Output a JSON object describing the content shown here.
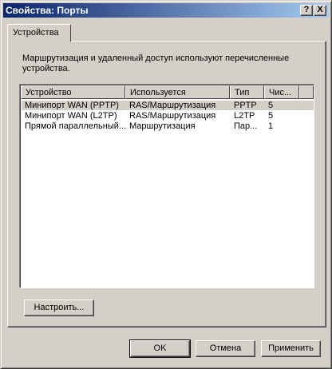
{
  "window": {
    "title": "Свойства: Порты"
  },
  "titlebar_buttons": {
    "help": "?",
    "close": "X"
  },
  "tabs": [
    {
      "label": "Устройства"
    }
  ],
  "description": "Маршрутизация и удаленный доступ используют перечисленные устройства.",
  "table": {
    "columns": [
      "Устройство",
      "Используется",
      "Тип",
      "Чис..."
    ],
    "rows": [
      [
        "Минипорт WAN (PPTP)",
        "RAS/Маршрутизация",
        "PPTP",
        "5"
      ],
      [
        "Минипорт WAN (L2TP)",
        "RAS/Маршрутизация",
        "L2TP",
        "5"
      ],
      [
        "Прямой параллельный...",
        "Маршрутизация",
        "Пар...",
        "1"
      ]
    ]
  },
  "buttons": {
    "configure": "Настроить...",
    "ok": "OK",
    "cancel": "Отмена",
    "apply": "Применить"
  }
}
